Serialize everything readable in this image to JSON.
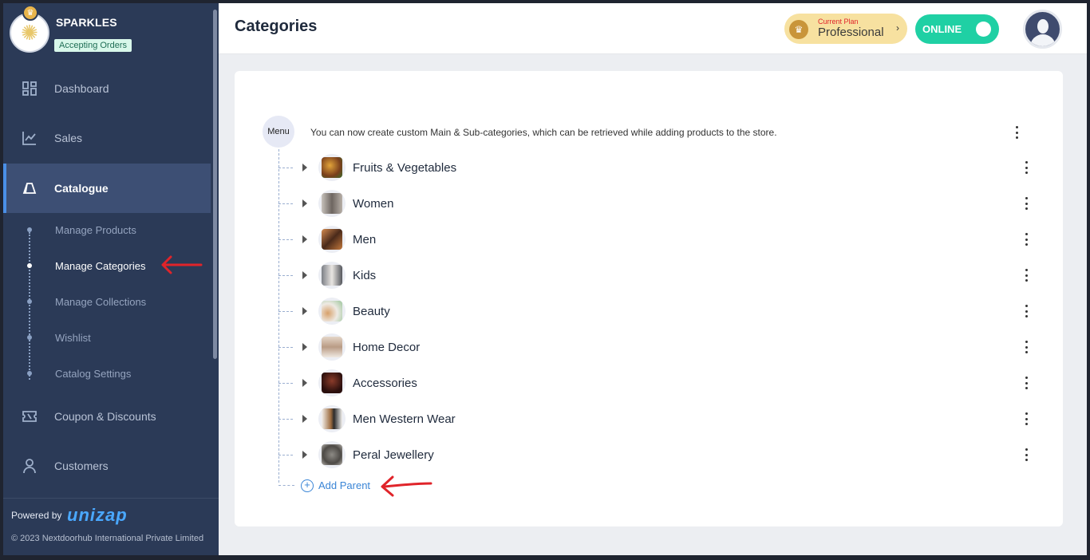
{
  "store": {
    "name": "SPARKLES",
    "status": "Accepting Orders"
  },
  "sidebar": {
    "items": [
      {
        "label": "Dashboard",
        "icon": "dashboard-icon"
      },
      {
        "label": "Sales",
        "icon": "chart-icon"
      },
      {
        "label": "Catalogue",
        "icon": "tag-icon",
        "active": true
      },
      {
        "label": "Coupon & Discounts",
        "icon": "coupon-icon"
      },
      {
        "label": "Customers",
        "icon": "user-icon"
      }
    ],
    "catalogue_sub": [
      {
        "label": "Manage Products"
      },
      {
        "label": "Manage Categories",
        "active": true
      },
      {
        "label": "Manage Collections"
      },
      {
        "label": "Wishlist"
      },
      {
        "label": "Catalog Settings"
      }
    ],
    "footer": {
      "powered_by": "Powered by",
      "brand": "unizap",
      "copyright": "© 2023 Nextdoorhub International Private Limited"
    }
  },
  "header": {
    "title": "Categories",
    "plan_label": "Current Plan",
    "plan_name": "Professional",
    "online_label": "ONLINE"
  },
  "categories": {
    "menu_label": "Menu",
    "description": "You can now create custom Main & Sub-categories, which can be retrieved while adding products to the store.",
    "items": [
      {
        "label": "Fruits & Vegetables"
      },
      {
        "label": "Women"
      },
      {
        "label": "Men"
      },
      {
        "label": "Kids"
      },
      {
        "label": "Beauty"
      },
      {
        "label": "Home Decor"
      },
      {
        "label": "Accessories"
      },
      {
        "label": "Men Western Wear"
      },
      {
        "label": "Peral Jewellery"
      }
    ],
    "add_parent_label": "Add Parent"
  },
  "colors": {
    "sidebar_bg": "#2b3a57",
    "accent_blue": "#4a8fe7",
    "online_green": "#1fd0a4",
    "plan_gold": "#f7e1a0",
    "annotation_red": "#e0242a"
  }
}
